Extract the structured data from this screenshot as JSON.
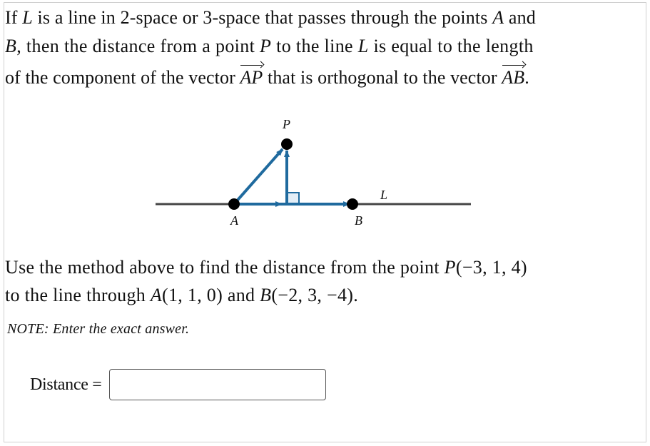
{
  "intro": {
    "line1": [
      "If ",
      {
        "m": "L"
      },
      " is a line in 2-space or 3-space that passes through the points ",
      {
        "m": "A"
      },
      " and"
    ],
    "line1_parts": {
      "a": "If ",
      "b": "L",
      "c": " is a line in 2-space or 3-space that passes through the points ",
      "d": "A",
      "e": " and"
    },
    "line2_parts": {
      "a": "B",
      "b": ", then the distance from a point ",
      "c": "P",
      "d": " to the line ",
      "e": "L",
      "f": " is equal to the length"
    },
    "line3_parts": {
      "a": "of the component of the vector ",
      "b": "AP",
      "c": " that is orthogonal to the vector ",
      "d": "AB",
      "e": "."
    }
  },
  "diagram": {
    "labels": {
      "P": "P",
      "A": "A",
      "B": "B",
      "L": "L"
    },
    "colors": {
      "vector": "#1f6a9e",
      "line": "#444444",
      "point": "#000000",
      "right_angle_fill": "#e3eef7"
    }
  },
  "question": {
    "line1_parts": {
      "a": "Use the method above to find the distance from the point ",
      "b": "P",
      "c": "(−3, 1, 4)"
    },
    "line2_parts": {
      "a": "to the line through ",
      "b": "A",
      "c": "(1, 1, 0)",
      "d": " and ",
      "e": "B",
      "f": "(−2, 3, −4)",
      "g": "."
    },
    "note": "NOTE: Enter the exact answer."
  },
  "answer": {
    "label": "Distance =",
    "value": "",
    "placeholder": ""
  }
}
